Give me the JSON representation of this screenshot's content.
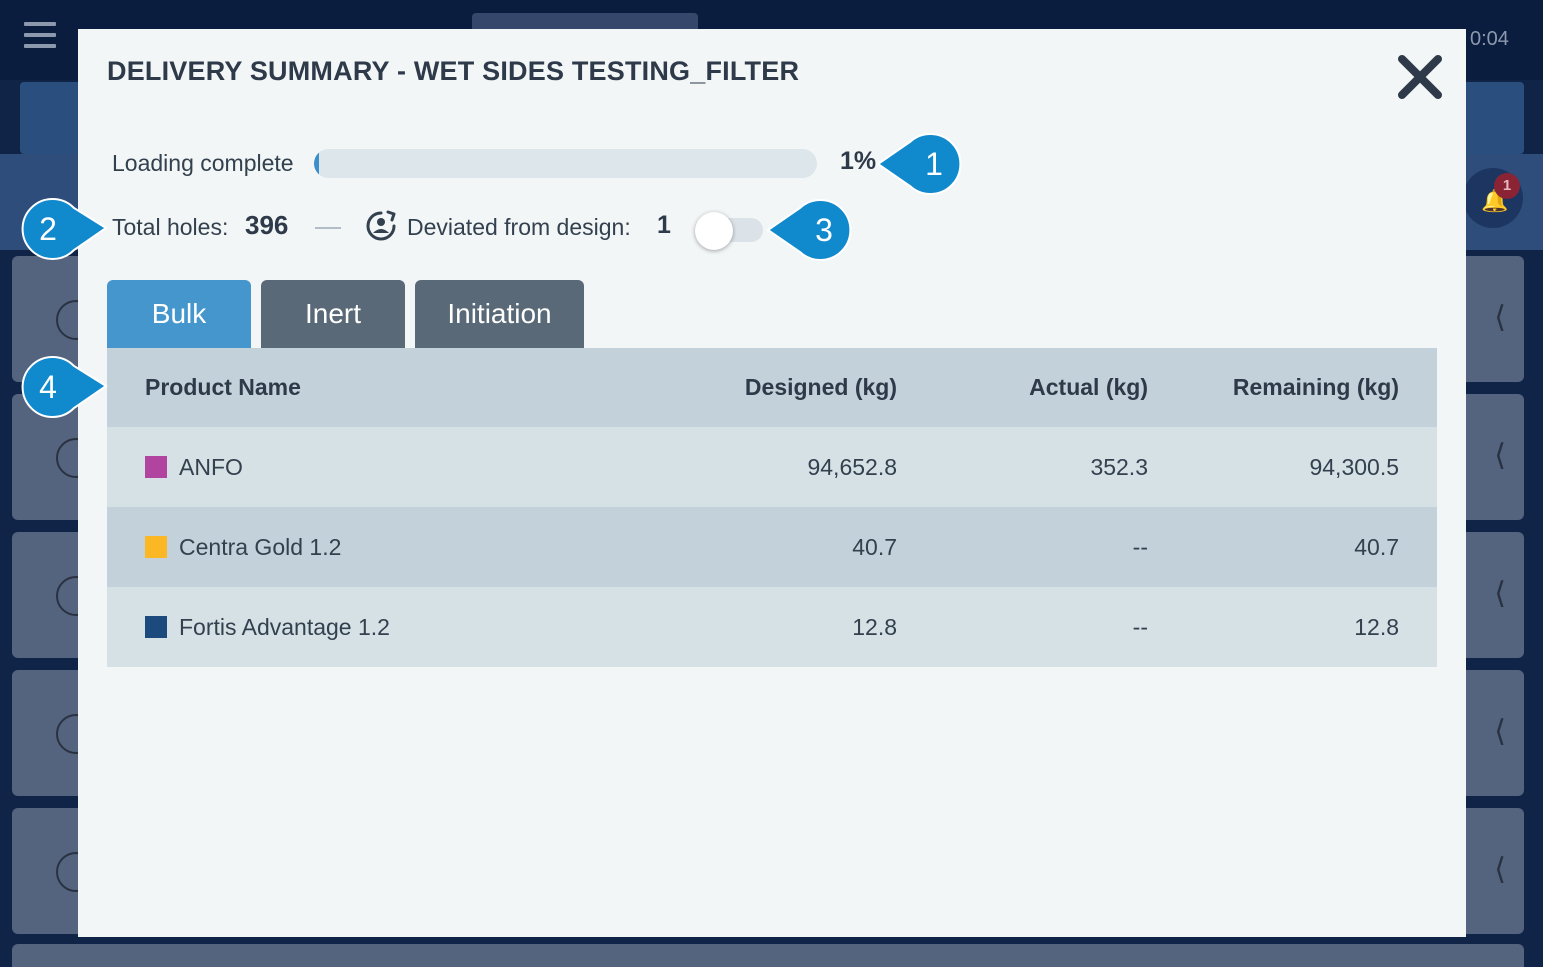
{
  "background": {
    "clock_text": "0:04",
    "notification_count": "1"
  },
  "modal": {
    "title": "DELIVERY SUMMARY - WET SIDES TESTING_FILTER",
    "close_icon": "close-icon",
    "progress": {
      "label": "Loading complete",
      "percent": 1,
      "percent_text": "1%"
    },
    "stats": {
      "total_holes_label": "Total holes:",
      "total_holes_value": "396",
      "deviated_label": "Deviated from design:",
      "deviated_value": "1",
      "deviated_icon": "deviation-icon",
      "toggle_on": false
    },
    "tabs": [
      {
        "label": "Bulk",
        "active": true
      },
      {
        "label": "Inert",
        "active": false
      },
      {
        "label": "Initiation",
        "active": false
      }
    ],
    "table": {
      "headers": {
        "product": "Product Name",
        "designed": "Designed (kg)",
        "actual": "Actual (kg)",
        "remaining": "Remaining (kg)"
      },
      "rows": [
        {
          "color": "#b0449e",
          "product": "ANFO",
          "designed": "94,652.8",
          "actual": "352.3",
          "remaining": "94,300.5"
        },
        {
          "color": "#fbb824",
          "product": "Centra Gold 1.2",
          "designed": "40.7",
          "actual": "--",
          "remaining": "40.7"
        },
        {
          "color": "#1d4a7c",
          "product": "Fortis Advantage 1.2",
          "designed": "12.8",
          "actual": "--",
          "remaining": "12.8"
        }
      ]
    }
  },
  "callouts": [
    "1",
    "2",
    "3",
    "4"
  ],
  "colors": {
    "accent": "#4596cd",
    "callout": "#1189cd",
    "tab_inactive": "#5a6977"
  }
}
